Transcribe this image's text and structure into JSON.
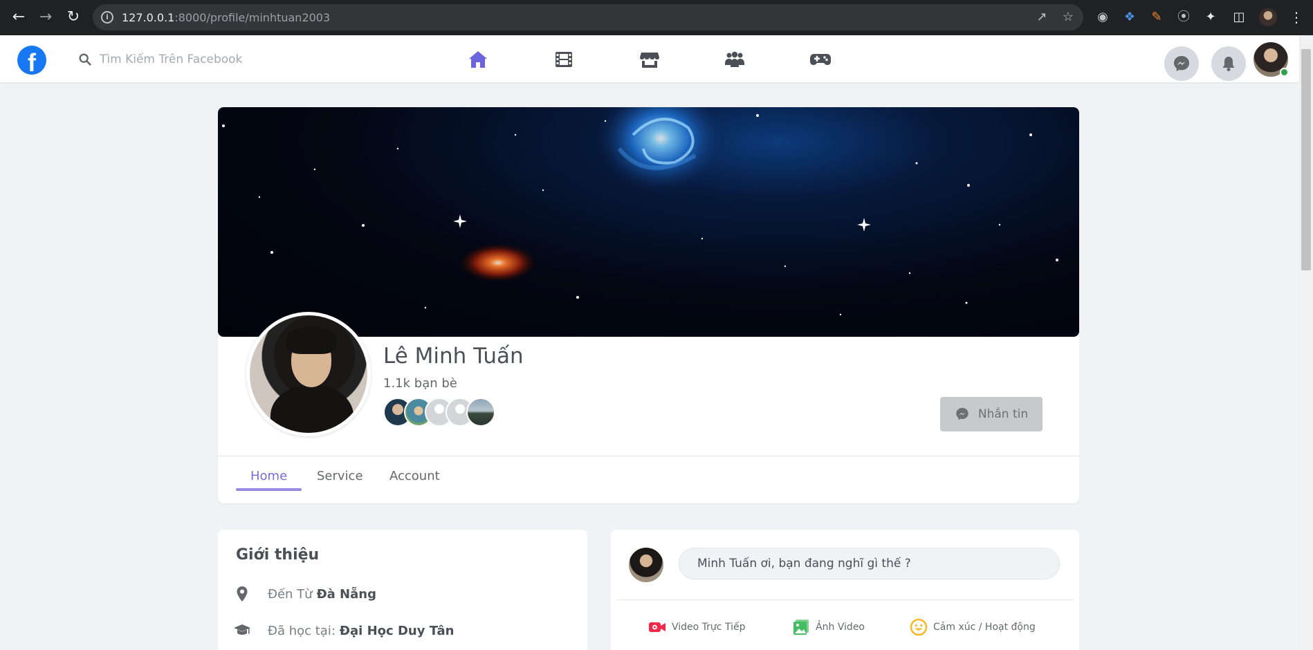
{
  "browser": {
    "url_host": "127.0.0.1",
    "url_path": ":8000/profile/minhtuan2003"
  },
  "header": {
    "logo_letter": "f",
    "search_placeholder": "Tìm Kiếm Trên Facebook",
    "nav_tabs": [
      "home-icon",
      "video-icon",
      "marketplace-icon",
      "groups-icon",
      "gaming-icon"
    ],
    "accent_color": "#6c63e0"
  },
  "profile": {
    "name": "Lê Minh Tuấn",
    "friend_count": "1.1k bạn bè",
    "message_button": "Nhắn tin",
    "tabs": [
      {
        "label": "Home",
        "active": true
      },
      {
        "label": "Service",
        "active": false
      },
      {
        "label": "Account",
        "active": false
      }
    ]
  },
  "intro": {
    "title": "Giới thiệu",
    "rows": [
      {
        "icon": "location-icon",
        "label": "Đến Từ",
        "value": "Đà Nẵng"
      },
      {
        "icon": "graduation-cap-icon",
        "label": "Đã học tại:",
        "value": "Đại Học Duy Tân"
      }
    ]
  },
  "composer": {
    "prompt": "Minh Tuấn ơi, bạn đang nghĩ gì thế ?",
    "actions": [
      {
        "icon": "live-video-icon",
        "label": "Video Trực Tiếp",
        "color": "#f02849"
      },
      {
        "icon": "photo-video-icon",
        "label": "Ảnh Video",
        "color": "#45bd62"
      },
      {
        "icon": "feeling-icon",
        "label": "Cảm xúc / Hoạt động",
        "color": "#f7b928"
      }
    ]
  }
}
